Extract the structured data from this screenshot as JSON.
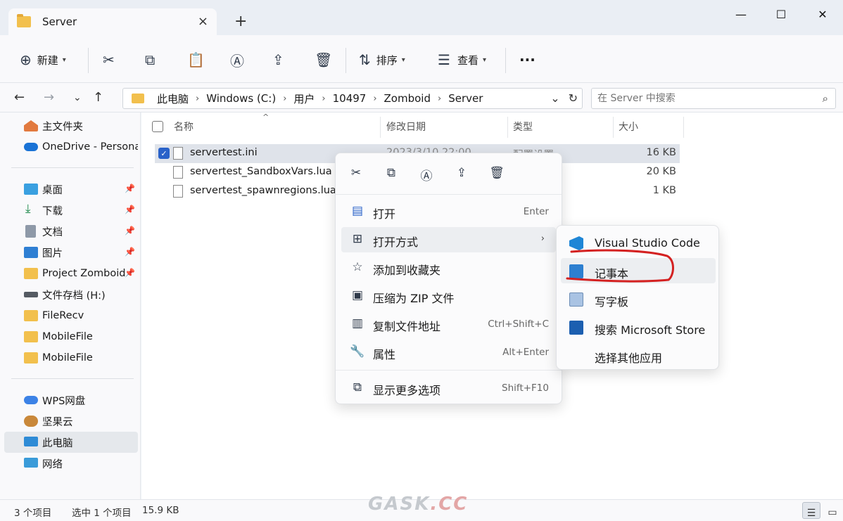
{
  "window": {
    "tab_title": "Server",
    "close_tab": "×",
    "new_tab": "+",
    "minimize": "—",
    "maximize": "☐",
    "close": "✕"
  },
  "toolbar": {
    "new_label": "新建",
    "sort_label": "排序",
    "view_label": "查看",
    "more_label": "···"
  },
  "address": {
    "crumbs": [
      "此电脑",
      "Windows (C:)",
      "用户",
      "10497",
      "Zomboid",
      "Server"
    ],
    "search_placeholder": "在 Server 中搜索"
  },
  "sidebar": {
    "items": [
      {
        "label": "主文件夹",
        "icon": "home-icon"
      },
      {
        "label": "OneDrive - Personal",
        "icon": "cloud-icon"
      },
      {
        "label": "桌面",
        "icon": "desktop-icon",
        "pinned": true
      },
      {
        "label": "下载",
        "icon": "download-icon",
        "pinned": true
      },
      {
        "label": "文档",
        "icon": "document-icon",
        "pinned": true
      },
      {
        "label": "图片",
        "icon": "picture-icon",
        "pinned": true
      },
      {
        "label": "Project Zomboid",
        "icon": "folder-icon",
        "pinned": true
      },
      {
        "label": "文件存档 (H:)",
        "icon": "drive-icon"
      },
      {
        "label": "FileRecv",
        "icon": "folder-icon"
      },
      {
        "label": "MobileFile",
        "icon": "folder-icon"
      },
      {
        "label": "MobileFile",
        "icon": "folder-icon"
      },
      {
        "label": "WPS网盘",
        "icon": "wps-cloud-icon"
      },
      {
        "label": "坚果云",
        "icon": "nutstore-icon"
      },
      {
        "label": "此电脑",
        "icon": "computer-icon",
        "selected": true
      },
      {
        "label": "网络",
        "icon": "network-icon"
      }
    ]
  },
  "columns": {
    "name": "名称",
    "date": "修改日期",
    "type": "类型",
    "size": "大小"
  },
  "files": [
    {
      "name": "servertest.ini",
      "size": "16 KB",
      "selected": true,
      "date": "2023/3/10 22:00",
      "type": "配置设置"
    },
    {
      "name": "servertest_SandboxVars.lua",
      "size": "20 KB",
      "selected": false
    },
    {
      "name": "servertest_spawnregions.lua",
      "size": "1 KB",
      "selected": false
    }
  ],
  "context_menu": {
    "items": [
      {
        "label": "打开",
        "shortcut": "Enter",
        "icon": "notepad-icon"
      },
      {
        "label": "打开方式",
        "shortcut": "",
        "icon": "open-with-icon",
        "submenu": true
      },
      {
        "label": "添加到收藏夹",
        "shortcut": "",
        "icon": "star-icon"
      },
      {
        "label": "压缩为 ZIP 文件",
        "shortcut": "",
        "icon": "zip-icon"
      },
      {
        "label": "复制文件地址",
        "shortcut": "Ctrl+Shift+C",
        "icon": "copy-path-icon"
      },
      {
        "label": "属性",
        "shortcut": "Alt+Enter",
        "icon": "wrench-icon"
      },
      {
        "label": "显示更多选项",
        "shortcut": "Shift+F10",
        "icon": "more-options-icon"
      }
    ],
    "arrow": "›"
  },
  "submenu": {
    "items": [
      {
        "label": "Visual Studio Code",
        "icon": "vscode-icon"
      },
      {
        "label": "记事本",
        "icon": "notepad-icon"
      },
      {
        "label": "写字板",
        "icon": "wordpad-icon"
      },
      {
        "label": "搜索 Microsoft Store",
        "icon": "store-icon"
      },
      {
        "label": "选择其他应用",
        "icon": ""
      }
    ]
  },
  "status": {
    "count": "3 个项目",
    "selected": "选中 1 个项目",
    "size": "15.9 KB"
  },
  "watermark": {
    "left": "GASK",
    "right": ".CC"
  },
  "colors": {
    "accent": "#2a62c9",
    "folder": "#f2c04d",
    "annotation": "#d42121"
  }
}
